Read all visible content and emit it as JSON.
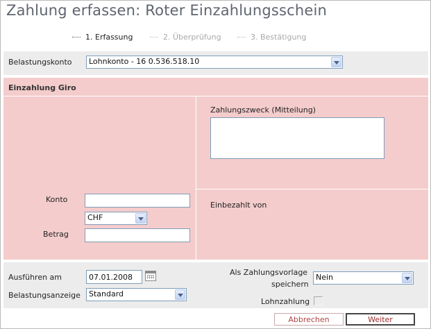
{
  "page": {
    "title": "Zahlung erfassen: Roter Einzahlungsschein"
  },
  "steps": [
    {
      "label": "1. Erfassung",
      "active": true
    },
    {
      "label": "2. Überprüfung",
      "active": false
    },
    {
      "label": "3. Bestätigung",
      "active": false
    }
  ],
  "debit_account": {
    "label": "Belastungskonto",
    "selected": "Lohnkonto - 16 0.536.518.10"
  },
  "section": {
    "title": "Einzahlung Giro"
  },
  "payment_purpose": {
    "label": "Zahlungszweck (Mitteilung)",
    "value": ""
  },
  "paid_by": {
    "label": "Einbezahlt von"
  },
  "account": {
    "label": "Konto",
    "value": ""
  },
  "currency": {
    "selected": "CHF"
  },
  "amount": {
    "label": "Betrag",
    "value": ""
  },
  "execute_on": {
    "label": "Ausführen am",
    "value": "07.01.2008"
  },
  "debit_display": {
    "label": "Belastungsanzeige",
    "selected": "Standard"
  },
  "save_template": {
    "label_line1": "Als Zahlungsvorlage",
    "label_line2": "speichern",
    "selected": "Nein"
  },
  "salary_payment": {
    "label": "Lohnzahlung",
    "checked": false
  },
  "buttons": {
    "cancel": "Abbrechen",
    "next": "Weiter"
  },
  "colors": {
    "pink_panel": "#f4cccc",
    "gray_panel": "#ececec",
    "title": "#5f6470",
    "button_text": "#9b2a2a"
  }
}
